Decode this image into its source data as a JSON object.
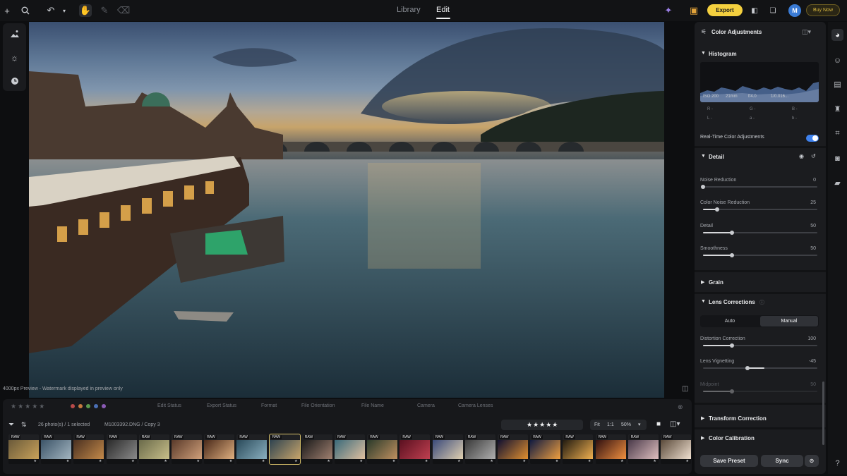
{
  "topbar": {
    "tabs": [
      {
        "label": "Library"
      },
      {
        "label": "Edit"
      }
    ],
    "export_label": "Export",
    "avatar_letter": "M",
    "buy_label": "Buy Now"
  },
  "preview_note": "4000px Preview - Watermark displayed in preview only",
  "filmstrip": {
    "filters": {
      "edit_status": "Edit Status",
      "export_status": "Export Status",
      "format": "Format",
      "file_orientation": "File Orientation",
      "file_name": "File Name",
      "camera": "Camera",
      "camera_lenses": "Camera Lenses"
    },
    "count_text": "26 photo(s) / 1 selected",
    "file_text": "M1003392.DNG / Copy 3",
    "zoom": {
      "fit": "Fit",
      "one": "1:1",
      "value": "50%"
    },
    "raw_badge": "RAW",
    "thumb_count": 21,
    "selected_index": 8
  },
  "panel": {
    "title": "Color Adjustments",
    "histogram": {
      "label": "Histogram",
      "meta": [
        "ISO 200",
        "21mm",
        "f/4.0",
        "1/0.016..."
      ],
      "rgb": [
        "R -",
        "G -",
        "B -"
      ],
      "lab": [
        "L -",
        "a -",
        "b -"
      ]
    },
    "realtime_label": "Real-Time Color Adjustments",
    "realtime_on": true,
    "detail": {
      "label": "Detail",
      "sliders": [
        {
          "label": "Noise Reduction",
          "value": "0",
          "pos": 0.0
        },
        {
          "label": "Color Noise Reduction",
          "value": "25",
          "pos": 0.25
        },
        {
          "label": "Detail",
          "value": "50",
          "pos": 0.5
        },
        {
          "label": "Smoothness",
          "value": "50",
          "pos": 0.5
        }
      ]
    },
    "grain_label": "Grain",
    "lens": {
      "label": "Lens Corrections",
      "auto": "Auto",
      "manual": "Manual",
      "sliders": [
        {
          "label": "Distortion Correction",
          "value": "100",
          "pos": 0.5
        },
        {
          "label": "Lens Vignetting",
          "value": "-45",
          "pos": -0.45
        },
        {
          "label": "Midpoint",
          "value": "50",
          "pos": 0.5
        }
      ]
    },
    "transform_label": "Transform Correction",
    "calibration_label": "Color Calibration",
    "save_preset": "Save Preset",
    "sync": "Sync"
  },
  "colors": {
    "accent": "#f4d03f",
    "toggle": "#3f82ee",
    "panel": "#1b1c1f"
  },
  "icons": [
    "add-icon",
    "search-icon",
    "undo-icon",
    "hand-icon",
    "brush-icon",
    "eraser-icon",
    "gift-icon",
    "ai-icon",
    "sparkle-icon",
    "sun-icon",
    "clock-icon",
    "palette-icon",
    "person-icon",
    "layers-icon",
    "shirt-icon",
    "crop-icon",
    "camera-icon",
    "folder-icon",
    "question-icon"
  ]
}
